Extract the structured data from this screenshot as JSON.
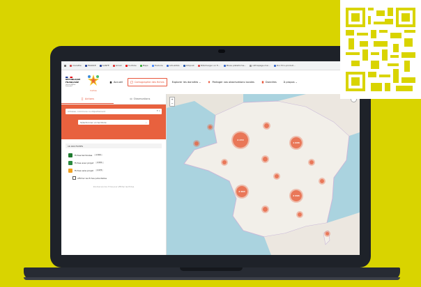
{
  "bookmarks": [
    {
      "label": "marathe"
    },
    {
      "label": "FRANCE"
    },
    {
      "label": "SANTÉ"
    },
    {
      "label": "Gmail"
    },
    {
      "label": "YouTube"
    },
    {
      "label": "Maps"
    },
    {
      "label": "Traduire"
    },
    {
      "label": "Actualités"
    },
    {
      "label": "Infopost"
    },
    {
      "label": "Télécharger un fi..."
    },
    {
      "label": "Mises plateforme..."
    },
    {
      "label": "rattrapage-mai..."
    },
    {
      "label": "Doc Eco-produit..."
    }
  ],
  "header": {
    "republique_lines": [
      "RÉPUBLIQUE",
      "FRANÇAISE"
    ],
    "motto": "Liberté Égalité Fraternité",
    "site_name": "Cartes",
    "nav": [
      {
        "label": "Accueil",
        "icon": "home-icon",
        "active": false
      },
      {
        "label": "Cartographie des fiches",
        "icon": "map-icon",
        "active": true
      },
      {
        "label": "Explorer les données ⌄",
        "icon": "",
        "active": false
      },
      {
        "label": "Partager vos observations locales",
        "icon": "pin-icon",
        "active": false
      },
      {
        "label": "Données",
        "icon": "file-icon",
        "active": false
      },
      {
        "label": "À propos ⌄",
        "icon": "",
        "active": false
      }
    ]
  },
  "panel": {
    "tabs": [
      {
        "label": "Actions",
        "active": true
      },
      {
        "label": "Observations",
        "active": false
      }
    ],
    "search_placeholder": "Adresse, commune ou département",
    "select_value": "Sélectionner un territoire",
    "count_text": "16 000 FICHES",
    "legend": [
      {
        "label": "Fiches terminées",
        "badge": "1 500",
        "color": "#1e7a2e"
      },
      {
        "label": "Fiches avec projet",
        "badge": "4 001",
        "color": "#2b8a3e"
      },
      {
        "label": "Fiches sans projet",
        "badge": "1 675",
        "color": "#f0a020"
      }
    ],
    "checkbox_label": "Afficher les fiches potentielles",
    "zoom_hint": "Zoomez encore 3 fois pour afficher les fiches"
  },
  "map": {
    "zoom_in": "+",
    "zoom_out": "−",
    "clusters": [
      {
        "label": "2 272"
      },
      {
        "label": "1 048"
      },
      {
        "label": "2 004"
      },
      {
        "label": "2 096"
      }
    ]
  },
  "colors": {
    "accent": "#e8613e",
    "background": "#d9d400",
    "laptop": "#1e2229"
  }
}
